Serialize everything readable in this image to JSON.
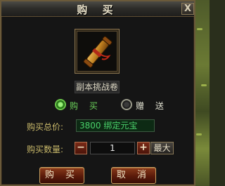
{
  "window": {
    "title": "购 买",
    "close_label": "X"
  },
  "item": {
    "name": "副本挑战卷",
    "icon": "scroll-icon"
  },
  "options": {
    "buy_label": "购 买",
    "gift_label": "赠 送",
    "selected": "buy"
  },
  "price": {
    "label": "购买总价:",
    "value": "3800 绑定元宝"
  },
  "quantity": {
    "label": "购买数量:",
    "value": "1",
    "minus_label": "−",
    "plus_label": "+",
    "max_label": "最大"
  },
  "actions": {
    "buy_label": "购 买",
    "cancel_label": "取 消"
  },
  "colors": {
    "price_text": "#4ad06a",
    "label_text": "#c9b96a",
    "buy_option_text": "#6ad05a",
    "gift_option_text": "#e0e0d0"
  }
}
